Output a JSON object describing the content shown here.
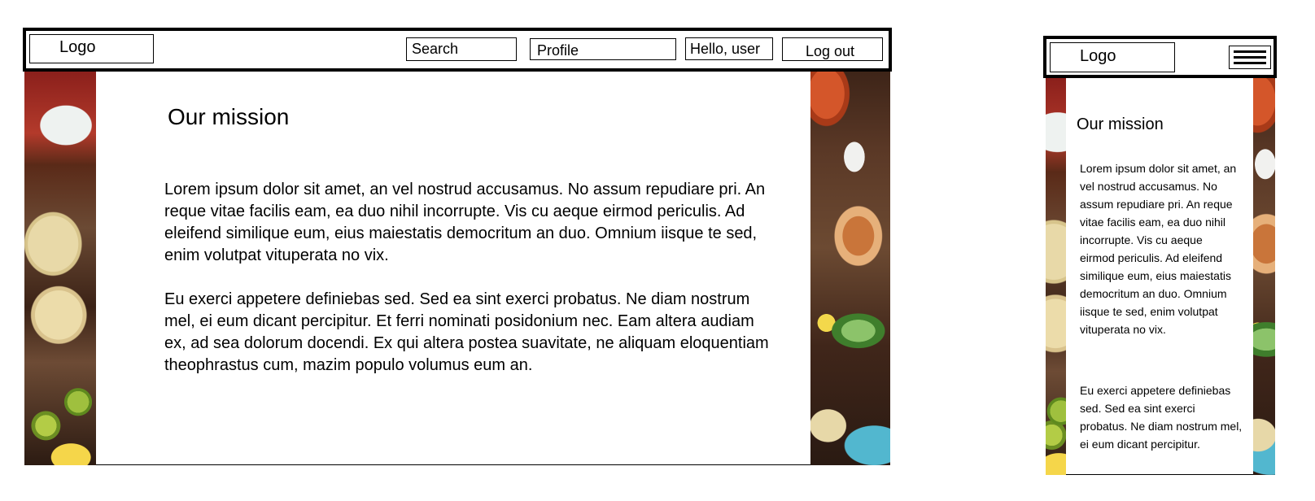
{
  "desktop": {
    "nav": {
      "logo": "Logo",
      "search": "Search",
      "profile": "Profile",
      "greeting": "Hello, user",
      "logout": "Log out"
    },
    "main": {
      "title": "Our mission",
      "paragraphs": [
        "Lorem ipsum dolor sit amet, an vel nostrud accusamus. No assum repudiare pri. An reque vitae facilis eam, ea duo nihil incorrupte. Vis cu aeque eirmod periculis. Ad eleifend similique eum, eius maiestatis democritum an duo. Omnium iisque te sed, enim volutpat vituperata no vix.",
        "Eu exerci appetere definiebas sed. Sed ea sint exerci probatus. Ne diam nostrum mel, ei eum dicant percipitur. Et ferri nominati posidonium nec. Eam altera audiam ex, ad sea dolorum docendi. Ex qui altera postea suavitate, ne aliquam eloquentiam theophrastus cum, mazim populo volumus eum an."
      ]
    }
  },
  "mobile": {
    "nav": {
      "logo": "Logo",
      "menu_icon": "hamburger-menu-icon"
    },
    "main": {
      "title": "Our mission",
      "paragraphs": [
        "Lorem ipsum dolor sit amet, an vel nostrud accusamus. No assum repudiare pri. An reque vitae facilis eam, ea duo nihil incorrupte. Vis cu aeque eirmod periculis. Ad eleifend similique eum, eius maiestatis democritum an duo. Omnium iisque te sed, enim volutpat vituperata no vix.",
        "Eu exerci appetere definiebas sed. Sed ea sint exerci probatus. Ne diam nostrum mel, ei eum dicant percipitur."
      ]
    }
  }
}
